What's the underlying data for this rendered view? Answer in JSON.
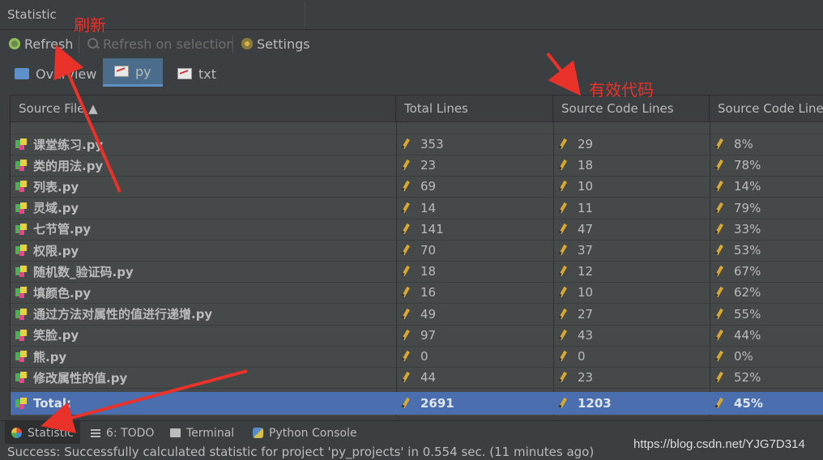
{
  "window": {
    "title": "Statistic"
  },
  "toolbar": {
    "refresh_label": "Refresh",
    "refresh_on_selection_label": "Refresh on selection",
    "settings_label": "Settings"
  },
  "tabs": [
    {
      "label": "Overview",
      "active": false
    },
    {
      "label": "py",
      "active": true
    },
    {
      "label": "txt",
      "active": false
    }
  ],
  "table": {
    "columns": [
      "Source File ▲",
      "Total Lines",
      "Source Code Lines",
      "Source Code Lines"
    ],
    "rows": [
      {
        "file": "课堂练习.py",
        "total": "353",
        "source": "29",
        "percent": "8%"
      },
      {
        "file": "类的用法.py",
        "total": "23",
        "source": "18",
        "percent": "78%"
      },
      {
        "file": "列表.py",
        "total": "69",
        "source": "10",
        "percent": "14%"
      },
      {
        "file": "灵域.py",
        "total": "14",
        "source": "11",
        "percent": "79%"
      },
      {
        "file": "七节管.py",
        "total": "141",
        "source": "47",
        "percent": "33%"
      },
      {
        "file": "权限.py",
        "total": "70",
        "source": "37",
        "percent": "53%"
      },
      {
        "file": "随机数_验证码.py",
        "total": "18",
        "source": "12",
        "percent": "67%"
      },
      {
        "file": "填颜色.py",
        "total": "16",
        "source": "10",
        "percent": "62%"
      },
      {
        "file": "通过方法对属性的值进行递增.py",
        "total": "49",
        "source": "27",
        "percent": "55%"
      },
      {
        "file": "笑脸.py",
        "total": "97",
        "source": "43",
        "percent": "44%"
      },
      {
        "file": "熊.py",
        "total": "0",
        "source": "0",
        "percent": "0%"
      },
      {
        "file": "修改属性的值.py",
        "total": "44",
        "source": "23",
        "percent": "52%"
      }
    ],
    "total": {
      "label": "Total:",
      "total": "2691",
      "source": "1203",
      "percent": "45%"
    }
  },
  "bottom_tools": [
    {
      "label": "Statistic",
      "icon": "statistic-icon",
      "active": true
    },
    {
      "label": "6: TODO",
      "icon": "todo-icon",
      "active": false
    },
    {
      "label": "Terminal",
      "icon": "terminal-icon",
      "active": false
    },
    {
      "label": "Python Console",
      "icon": "python-console-icon",
      "active": false
    }
  ],
  "status": {
    "message": "Success: Successfully calculated statistic for project 'py_projects' in 0.554 sec. (11 minutes ago)"
  },
  "watermark": "https://blog.csdn.net/YJG7D314",
  "annotations": {
    "refresh_note": "刷新",
    "code_note": "有效代码",
    "color": "#e8322a"
  }
}
